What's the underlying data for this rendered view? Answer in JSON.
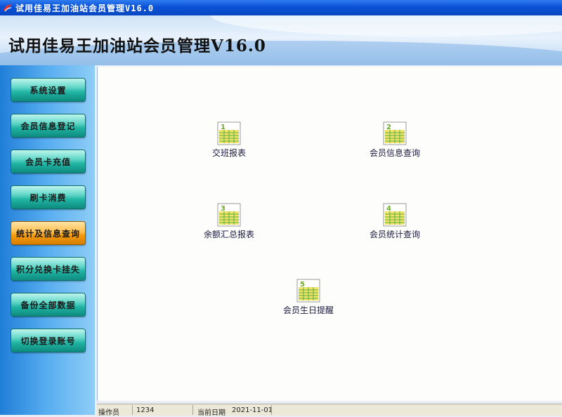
{
  "window": {
    "title": "试用佳易王加油站会员管理V16.0"
  },
  "banner": {
    "heading": "试用佳易王加油站会员管理V16.0"
  },
  "sidebar": {
    "items": [
      {
        "label": "系统设置"
      },
      {
        "label": "会员信息登记"
      },
      {
        "label": "会员卡充值"
      },
      {
        "label": "刷卡消费"
      },
      {
        "label": "统计及信息查询",
        "active": true
      },
      {
        "label": "积分兑换卡挂失"
      },
      {
        "label": "备份全部数据"
      },
      {
        "label": "切换登录账号"
      }
    ]
  },
  "reports": [
    {
      "number": "1",
      "label": "交班报表",
      "icon": "spreadsheet-icon"
    },
    {
      "number": "2",
      "label": "会员信息查询",
      "icon": "spreadsheet-icon"
    },
    {
      "number": "3",
      "label": "余额汇总报表",
      "icon": "spreadsheet-icon"
    },
    {
      "number": "4",
      "label": "会员统计查询",
      "icon": "spreadsheet-icon"
    },
    {
      "number": "5",
      "label": "会员生日提醒",
      "icon": "spreadsheet-icon"
    }
  ],
  "status": {
    "operator_label": "操作员",
    "operator_value": "1234",
    "date_label": "当前日期",
    "date_value": "2021-11-01"
  },
  "colors": {
    "titlebar": "#0a52d6",
    "nav_button": "#21b4a3",
    "nav_active": "#f39a0e"
  }
}
